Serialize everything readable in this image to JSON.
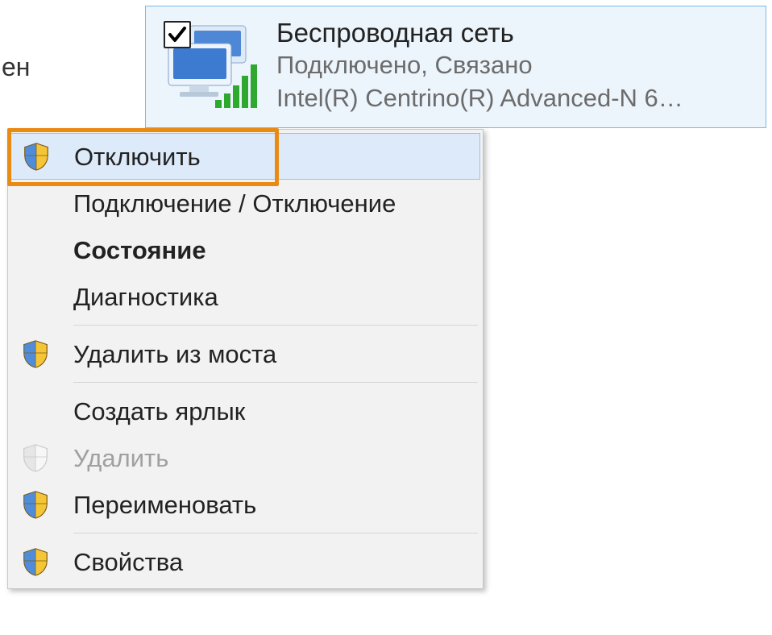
{
  "background_text": "ючен",
  "adapter": {
    "name": "Беспроводная сеть",
    "status": "Подключено, Связано",
    "device": "Intel(R) Centrino(R) Advanced-N 6…",
    "checked": true
  },
  "context_menu": {
    "items": [
      {
        "label": "Отключить",
        "icon": "shield",
        "hovered": true,
        "enabled": true
      },
      {
        "label": "Подключение / Отключение",
        "icon": "none",
        "enabled": true
      },
      {
        "label": "Состояние",
        "icon": "none",
        "bold": true,
        "enabled": true
      },
      {
        "label": "Диагностика",
        "icon": "none",
        "enabled": true
      },
      {
        "separator": true
      },
      {
        "label": "Удалить из моста",
        "icon": "shield",
        "enabled": true
      },
      {
        "separator": true
      },
      {
        "label": "Создать ярлык",
        "icon": "none",
        "enabled": true
      },
      {
        "label": "Удалить",
        "icon": "shield-disabled",
        "enabled": false
      },
      {
        "label": "Переименовать",
        "icon": "shield",
        "enabled": true
      },
      {
        "separator": true
      },
      {
        "label": "Свойства",
        "icon": "shield",
        "enabled": true
      }
    ]
  }
}
